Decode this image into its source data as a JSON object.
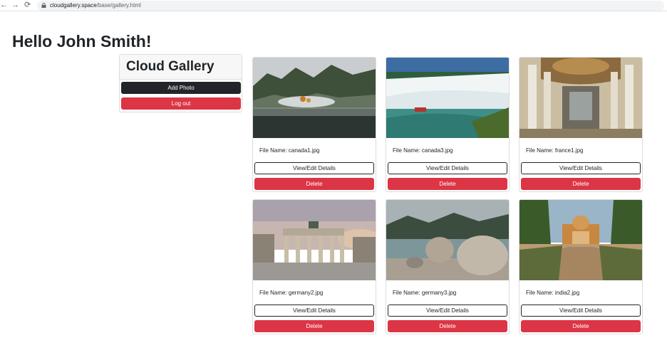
{
  "browser": {
    "back_icon": "←",
    "forward_icon": "→",
    "reload_icon": "⟳",
    "url_host": "cloudgallery.space",
    "url_path": "/base/gallery.html"
  },
  "greeting": "Hello John Smith!",
  "sidebar": {
    "title": "Cloud Gallery",
    "add_photo_label": "Add Photo",
    "logout_label": "Log out"
  },
  "colors": {
    "danger": "#dc3545",
    "dark": "#212529"
  },
  "photos": [
    {
      "file_label": "File Name: canada1.jpg",
      "view_label": "View/Edit Details",
      "delete_label": "Delete"
    },
    {
      "file_label": "File Name: canada3.jpg",
      "view_label": "View/Edit Details",
      "delete_label": "Delete"
    },
    {
      "file_label": "File Name: france1.jpg",
      "view_label": "View/Edit Details",
      "delete_label": "Delete"
    },
    {
      "file_label": "File Name: germany2.jpg",
      "view_label": "View/Edit Details",
      "delete_label": "Delete"
    },
    {
      "file_label": "File Name: germany3.jpg",
      "view_label": "View/Edit Details",
      "delete_label": "Delete"
    },
    {
      "file_label": "File Name: india2.jpg",
      "view_label": "View/Edit Details",
      "delete_label": "Delete"
    }
  ]
}
